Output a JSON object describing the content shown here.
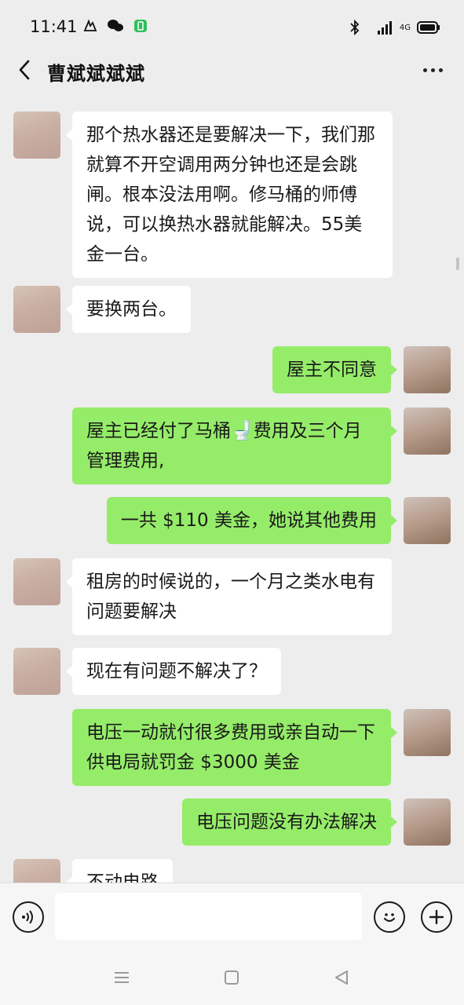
{
  "status_bar": {
    "time": "11:41",
    "network_label": "4G"
  },
  "header": {
    "title": "曹斌斌斌斌"
  },
  "messages": [
    {
      "side": "in",
      "text": "那个热水器还是要解决一下，我们那就算不开空调用两分钟也还是会跳闸。根本没法用啊。修马桶的师傅说，可以换热水器就能解决。55美金一台。"
    },
    {
      "side": "in",
      "text": "要换两台。"
    },
    {
      "side": "out",
      "text": "屋主不同意"
    },
    {
      "side": "out",
      "text": "屋主已经付了马桶🚽费用及三个月管理费用,"
    },
    {
      "side": "out",
      "text": "一共 $110 美金，她说其他费用"
    },
    {
      "side": "in",
      "text": "租房的时候说的，一个月之类水电有问题要解决"
    },
    {
      "side": "in",
      "text": "现在有问题不解决了？"
    },
    {
      "side": "out",
      "text": "电压一动就付很多费用或亲自动一下供电局就罚金 $3000 美金"
    },
    {
      "side": "out",
      "text": "电压问题没有办法解决"
    },
    {
      "side": "in",
      "text": "不动电路"
    }
  ],
  "input": {
    "placeholder": ""
  },
  "colors": {
    "background": "#ededed",
    "outgoing_bubble": "#95ec69",
    "incoming_bubble": "#ffffff"
  },
  "icons": {
    "back": "chevron-left-icon",
    "more": "more-dots-icon",
    "voice": "voice-icon",
    "emoji": "emoji-icon",
    "plus": "plus-icon"
  }
}
